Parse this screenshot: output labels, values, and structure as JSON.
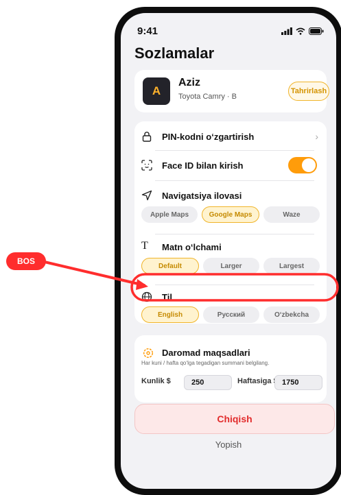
{
  "status": {
    "time": "9:41"
  },
  "page_title": "Sozlamalar",
  "profile": {
    "initial": "A",
    "name": "Aziz",
    "car": "Toyota Camry · B",
    "edit_label": "Tahrirlash"
  },
  "settings": {
    "pin_label": "PIN-kodni o‘zgartirish",
    "faceid_label": "Face ID bilan kirish",
    "faceid_on": true,
    "nav_label": "Navigatsiya ilovasi",
    "nav_options": [
      "Apple Maps",
      "Google Maps",
      "Waze"
    ],
    "nav_selected": "Google Maps",
    "text_label": "Matn o‘lchami",
    "text_options": [
      "Default",
      "Larger",
      "Largest"
    ],
    "text_selected": "Default",
    "lang_label": "Til",
    "lang_options": [
      "English",
      "Русский",
      "O‘zbekcha"
    ],
    "lang_selected": "English"
  },
  "income": {
    "label": "Daromad maqsadlari",
    "subtitle": "Har kuni / hafta qo‘lga tegadigan summani belgilang.",
    "daily_label": "Kunlik $",
    "daily_value": "250",
    "weekly_label": "Haftasiga $",
    "weekly_value": "1750"
  },
  "exit_label": "Chiqish",
  "close_label": "Yopish",
  "annotation_badge": "BOS",
  "colors": {
    "accent": "#ff9c0a",
    "annotation": "#ff2d2d",
    "danger": "#e22c2c"
  }
}
